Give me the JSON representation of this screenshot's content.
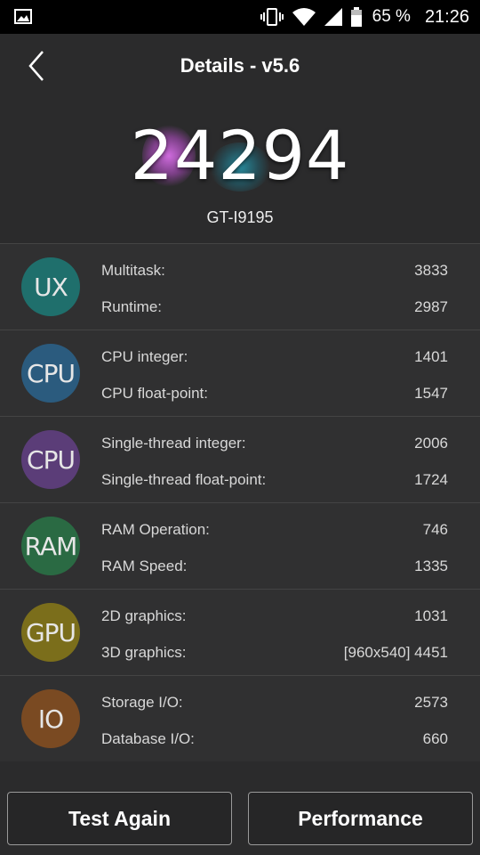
{
  "status_bar": {
    "battery_percent": "65 %",
    "time": "21:26",
    "icons": [
      "image-notification-icon",
      "vibrate-icon",
      "wifi-icon",
      "cell-signal-icon",
      "battery-icon"
    ]
  },
  "header": {
    "title": "Details - v5.6",
    "back_icon": "chevron-left-icon"
  },
  "score": {
    "total": "24294",
    "device": "GT-I9195"
  },
  "sections": [
    {
      "badge": "UX",
      "color": "#1f6f6c",
      "rows": [
        {
          "label": "Multitask:",
          "value": "3833"
        },
        {
          "label": "Runtime:",
          "value": "2987"
        }
      ]
    },
    {
      "badge": "CPU",
      "color": "#2b5b7e",
      "rows": [
        {
          "label": "CPU integer:",
          "value": "1401"
        },
        {
          "label": "CPU float-point:",
          "value": "1547"
        }
      ]
    },
    {
      "badge": "CPU",
      "color": "#5b3d78",
      "rows": [
        {
          "label": "Single-thread integer:",
          "value": "2006"
        },
        {
          "label": "Single-thread float-point:",
          "value": "1724"
        }
      ]
    },
    {
      "badge": "RAM",
      "color": "#2a6a43",
      "rows": [
        {
          "label": "RAM Operation:",
          "value": "746"
        },
        {
          "label": "RAM Speed:",
          "value": "1335"
        }
      ]
    },
    {
      "badge": "GPU",
      "color": "#7b6e1b",
      "rows": [
        {
          "label": "2D graphics:",
          "value": "1031"
        },
        {
          "label": "3D graphics:",
          "value": "[960x540] 4451"
        }
      ]
    },
    {
      "badge": "IO",
      "color": "#7a4a22",
      "rows": [
        {
          "label": "Storage I/O:",
          "value": "2573"
        },
        {
          "label": "Database I/O:",
          "value": "660"
        }
      ]
    }
  ],
  "buttons": {
    "test_again": "Test Again",
    "performance": "Performance"
  }
}
